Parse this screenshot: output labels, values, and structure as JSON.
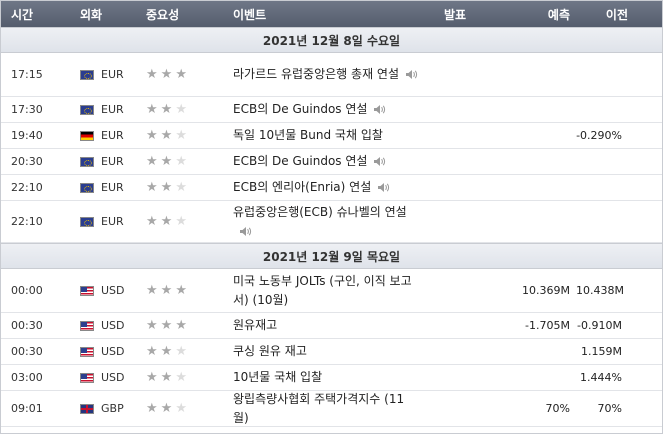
{
  "header": {
    "time": "시간",
    "currency": "외화",
    "importance": "중요성",
    "event": "이벤트",
    "actual": "발표",
    "forecast": "예측",
    "previous": "이전"
  },
  "days": [
    {
      "date": "2021년 12월 8일 수요일",
      "events": [
        {
          "time": "17:15",
          "flag": "eu",
          "currency": "EUR",
          "stars": 3,
          "event": "라가르드 유럽중앙은행 총재 연설",
          "speech": true,
          "actual": "",
          "forecast": "",
          "previous": ""
        },
        {
          "time": "17:30",
          "flag": "eu",
          "currency": "EUR",
          "stars": 2,
          "event": "ECB의 De Guindos 연설",
          "speech": true,
          "actual": "",
          "forecast": "",
          "previous": ""
        },
        {
          "time": "19:40",
          "flag": "de",
          "currency": "EUR",
          "stars": 2,
          "event": "독일 10년물 Bund 국채 입찰",
          "speech": false,
          "actual": "",
          "forecast": "",
          "previous": "-0.290%"
        },
        {
          "time": "20:30",
          "flag": "eu",
          "currency": "EUR",
          "stars": 2,
          "event": "ECB의 De Guindos 연설",
          "speech": true,
          "actual": "",
          "forecast": "",
          "previous": ""
        },
        {
          "time": "22:10",
          "flag": "eu",
          "currency": "EUR",
          "stars": 2,
          "event": "ECB의 엔리아(Enria) 연설",
          "speech": true,
          "actual": "",
          "forecast": "",
          "previous": ""
        },
        {
          "time": "22:10",
          "flag": "eu",
          "currency": "EUR",
          "stars": 2,
          "event": "유럽중앙은행(ECB) 슈나벨의 연설",
          "speech": true,
          "actual": "",
          "forecast": "",
          "previous": ""
        }
      ]
    },
    {
      "date": "2021년 12월 9일 목요일",
      "events": [
        {
          "time": "00:00",
          "flag": "us",
          "currency": "USD",
          "stars": 3,
          "event": "미국 노동부 JOLTs (구인, 이직 보고서) (10월)",
          "speech": false,
          "actual": "",
          "forecast": "10.369M",
          "previous": "10.438M"
        },
        {
          "time": "00:30",
          "flag": "us",
          "currency": "USD",
          "stars": 3,
          "event": "원유재고",
          "speech": false,
          "actual": "",
          "forecast": "-1.705M",
          "previous": "-0.910M"
        },
        {
          "time": "00:30",
          "flag": "us",
          "currency": "USD",
          "stars": 2,
          "event": "쿠싱 원유 재고",
          "speech": false,
          "actual": "",
          "forecast": "",
          "previous": "1.159M"
        },
        {
          "time": "03:00",
          "flag": "us",
          "currency": "USD",
          "stars": 2,
          "event": "10년물 국채 입찰",
          "speech": false,
          "actual": "",
          "forecast": "",
          "previous": "1.444%"
        },
        {
          "time": "09:01",
          "flag": "gb",
          "currency": "GBP",
          "stars": 2,
          "event": "왕립측량사협회 주택가격지수 (11월)",
          "speech": false,
          "actual": "",
          "forecast": "70%",
          "previous": "70%"
        }
      ]
    }
  ]
}
